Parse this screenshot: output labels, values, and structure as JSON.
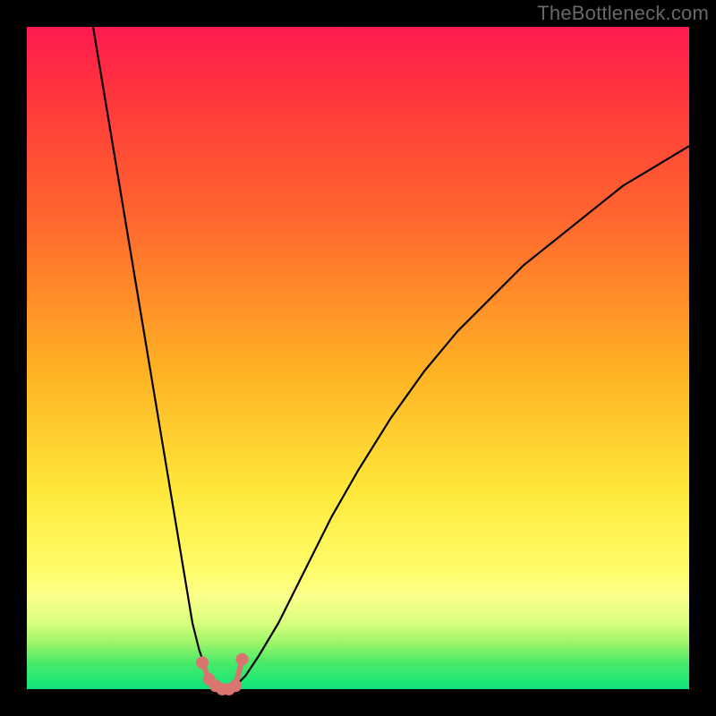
{
  "watermark": {
    "text": "TheBottleneck.com"
  },
  "chart_data": {
    "type": "line",
    "title": "",
    "xlabel": "",
    "ylabel": "",
    "xlim": [
      0,
      100
    ],
    "ylim": [
      0,
      100
    ],
    "grid": false,
    "series": [
      {
        "name": "curve",
        "x": [
          10,
          12,
          14,
          16,
          18,
          20,
          22,
          24,
          25,
          26,
          27,
          28,
          29,
          30,
          31,
          32,
          33,
          35,
          38,
          42,
          46,
          50,
          55,
          60,
          65,
          70,
          75,
          80,
          85,
          90,
          95,
          100
        ],
        "values": [
          100,
          88,
          76,
          64,
          52,
          40,
          28,
          16,
          10,
          6,
          3,
          1,
          0,
          0,
          0,
          1,
          2,
          5,
          10,
          18,
          26,
          33,
          41,
          48,
          54,
          59,
          64,
          68,
          72,
          76,
          79,
          82
        ]
      }
    ],
    "highlight": {
      "name": "minimum-cluster",
      "x": [
        26.5,
        27.5,
        28.5,
        29.5,
        30.5,
        31.5,
        32.5
      ],
      "values": [
        4,
        1.5,
        0.5,
        0,
        0,
        0.5,
        4.5
      ]
    },
    "colors": {
      "curve": "#000000",
      "highlight": "#d9756f",
      "gradient_top": "#ff1a4f",
      "gradient_bottom": "#12e07a"
    }
  }
}
